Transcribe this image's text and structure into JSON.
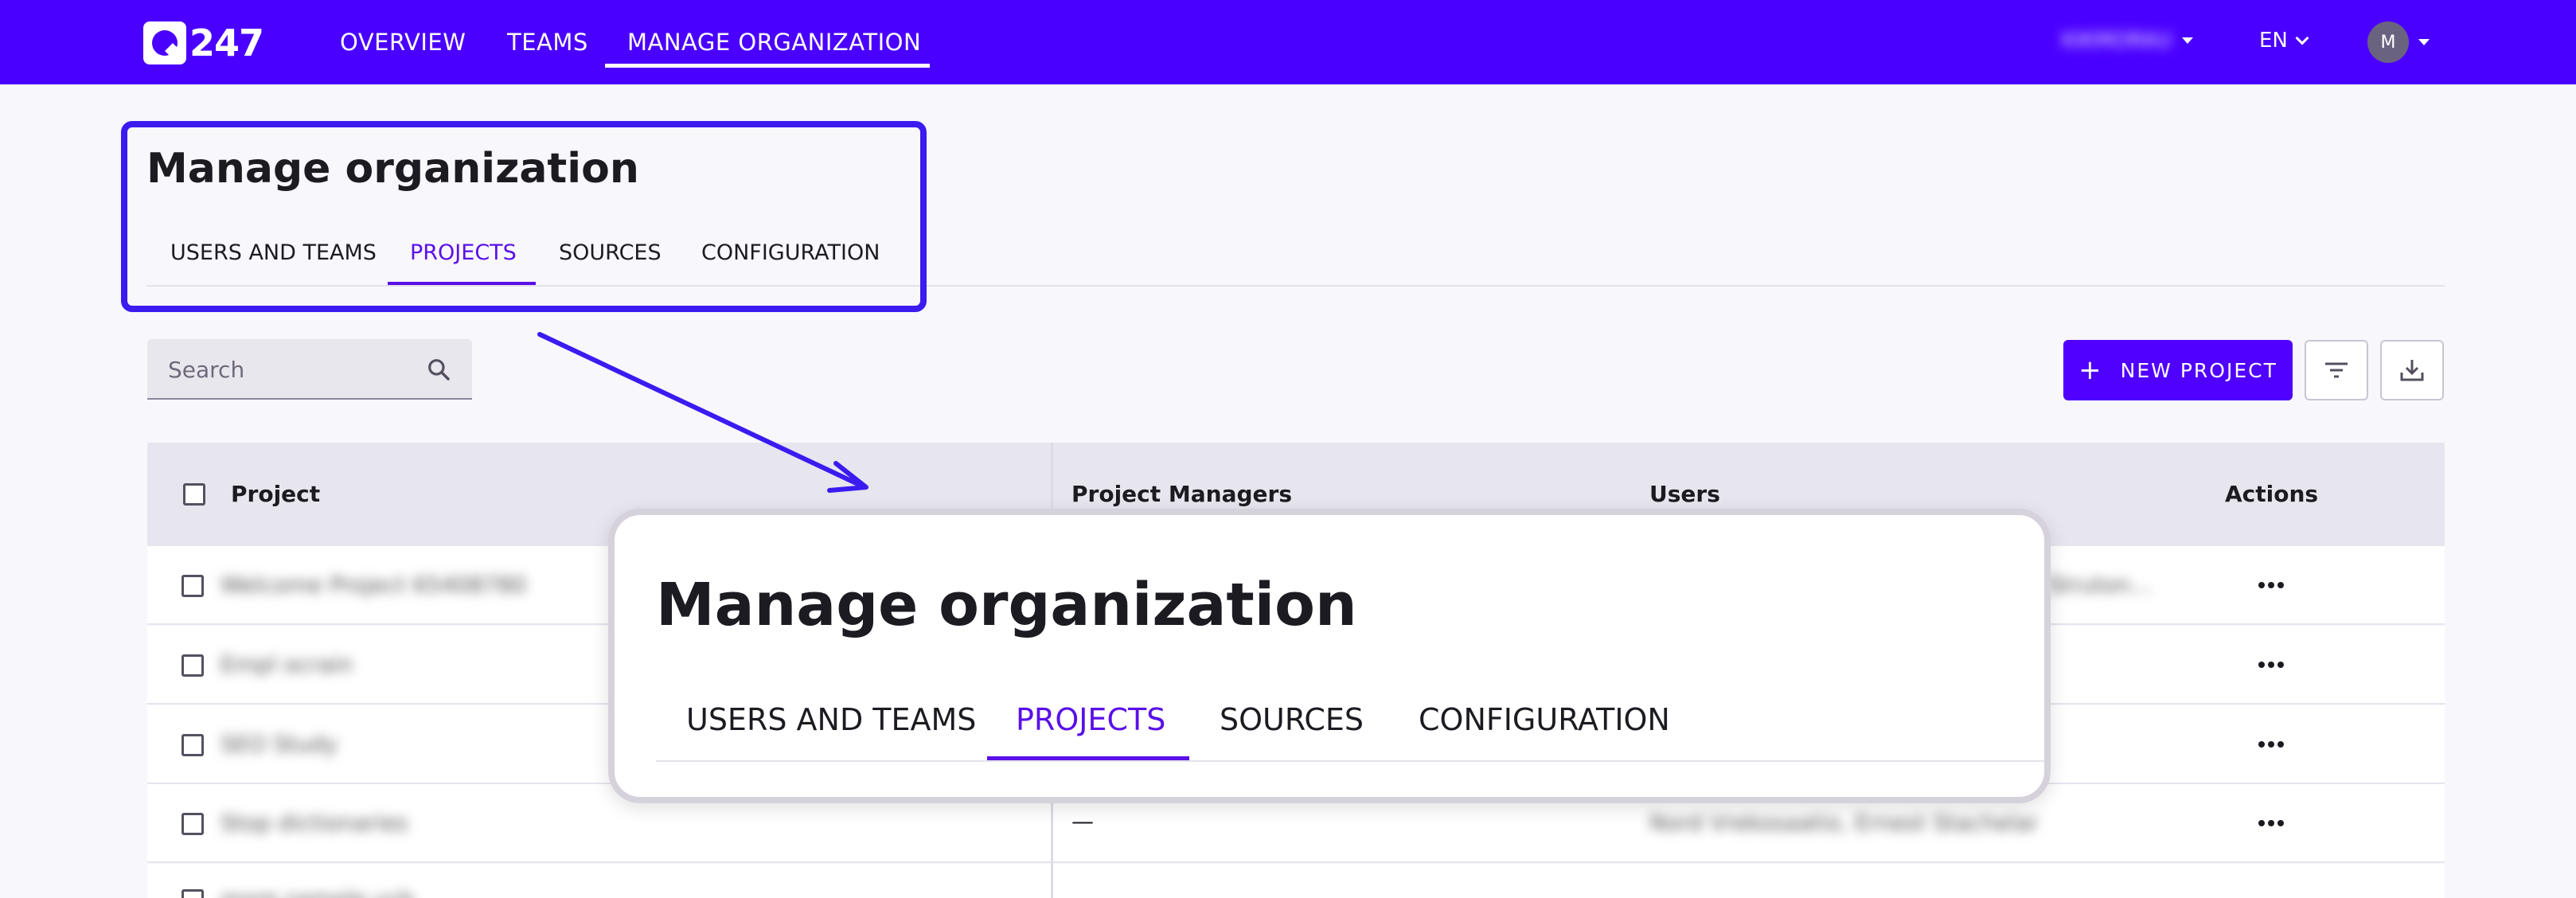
{
  "app": {
    "logo_text": "247",
    "nav": [
      "OVERVIEW",
      "TEAMS",
      "MANAGE ORGANIZATION"
    ],
    "active_nav": "MANAGE ORGANIZATION",
    "org_name": "KIKMORAU",
    "language": "EN",
    "avatar_initial": "M",
    "brand_color": "#4a00ff"
  },
  "page": {
    "title": "Manage organization",
    "tabs": [
      "USERS AND TEAMS",
      "PROJECTS",
      "SOURCES",
      "CONFIGURATION"
    ],
    "active_tab": "PROJECTS",
    "accent_color": "#5a10e8"
  },
  "toolbar": {
    "search_placeholder": "Search",
    "new_project_label": "NEW PROJECT"
  },
  "table": {
    "columns": [
      "Project",
      "Project Managers",
      "Users",
      "Actions"
    ],
    "rows": [
      {
        "project": "Welcome Project 65408780",
        "managers": "",
        "users": "Ivay Struton..."
      },
      {
        "project": "Empl ocrain",
        "managers": "",
        "users": ""
      },
      {
        "project": "SEO Study",
        "managers": "",
        "users": ""
      },
      {
        "project": "Stop dictionaries",
        "managers": "—",
        "users": "Nord Vrekosaatio, Ernest Stachelar"
      },
      {
        "project": "more sample ucb",
        "managers": "",
        "users": ""
      }
    ]
  },
  "callout": {
    "title": "Manage organization",
    "tabs": [
      "USERS AND TEAMS",
      "PROJECTS",
      "SOURCES",
      "CONFIGURATION"
    ],
    "active_tab": "PROJECTS"
  }
}
